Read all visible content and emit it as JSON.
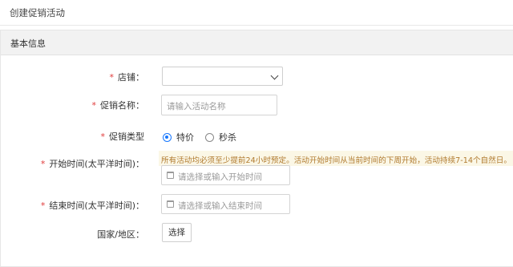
{
  "page": {
    "title": "创建促销活动"
  },
  "panel": {
    "header": "基本信息"
  },
  "form": {
    "required_mark": "*",
    "store": {
      "label": "店铺：",
      "value": ""
    },
    "promo_name": {
      "label": "促销名称：",
      "placeholder": "请输入活动名称"
    },
    "promo_type": {
      "label": "促销类型",
      "options": [
        {
          "label": "特价",
          "checked": true
        },
        {
          "label": "秒杀",
          "checked": false
        }
      ]
    },
    "start_time": {
      "label": "开始时间(太平洋时间)：",
      "notice": "所有活动均必须至少提前24小时预定。活动开始时间从当前时间的下周开始，活动持续7-14个自然日。",
      "placeholder": "请选择或输入开始时间",
      "icon": "calendar-icon"
    },
    "end_time": {
      "label": "结束时间(太平洋时间)：",
      "placeholder": "请选择或输入结束时间",
      "icon": "calendar-icon"
    },
    "region": {
      "label": "国家/地区：",
      "button_label": "选择"
    }
  },
  "colors": {
    "required": "#e03b3b",
    "accent": "#1677ff",
    "notice_bg": "#fbf7e6",
    "notice_text": "#b07a2e"
  }
}
